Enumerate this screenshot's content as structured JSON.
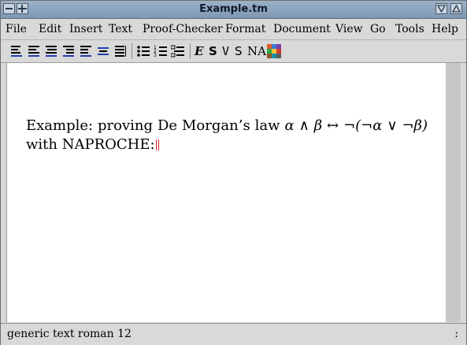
{
  "window": {
    "title": "Example.tm"
  },
  "menubar": {
    "items": [
      "File",
      "Edit",
      "Insert",
      "Text",
      "Proof-Checker",
      "Format",
      "Document",
      "View",
      "Go",
      "Tools",
      "Help"
    ]
  },
  "toolbar": {
    "alignment_icons": [
      "align-left-icon",
      "align-center-icon",
      "align-right-icon",
      "indent-icon",
      "outdent-icon",
      "center-icon",
      "justify-icon"
    ],
    "list_icons": [
      "bullet-list-icon",
      "numbered-list-icon",
      "description-list-icon"
    ],
    "style_buttons": {
      "emphasize": "E",
      "strong": "S",
      "verbatim": "V",
      "sans_serif": "S",
      "name": "NA"
    },
    "color_icon": "color-palette-icon"
  },
  "document": {
    "line1_text": "Example: proving De Morgan’s law",
    "formula": "α ∧ β ↔ ¬(¬α ∨ ¬β)",
    "line2_text": "with NAPROCHE:"
  },
  "status": {
    "left": "generic text roman 12",
    "right": ":"
  },
  "colors": {
    "titlebar": "#8aa2bc",
    "chrome": "#d9d9d9",
    "cursor": "#d12a2a"
  }
}
